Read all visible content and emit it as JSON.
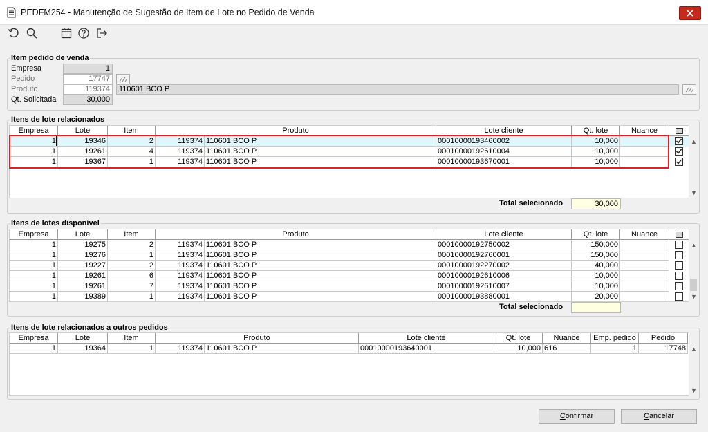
{
  "window": {
    "title": "PEDFM254 - Manutenção de Sugestão de Item de Lote no Pedido de Venda"
  },
  "icons": {
    "undo": "undo-icon",
    "search": "search-icon",
    "calendar": "calendar-icon",
    "help": "help-icon",
    "exit": "exit-icon"
  },
  "item_group": {
    "title": "Item pedido de venda",
    "empresa_label": "Empresa",
    "empresa_value": "1",
    "pedido_label": "Pedido",
    "pedido_value": "17747",
    "produto_label": "Produto",
    "produto_value": "119374",
    "produto_desc": "110601 BCO P",
    "qt_label": "Qt. Solicitada",
    "qt_value": "30,000"
  },
  "related": {
    "title": "Itens de lote relacionados",
    "headers": [
      "Empresa",
      "Lote",
      "Item",
      "Produto",
      "Lote cliente",
      "Qt. lote",
      "Nuance"
    ],
    "rows": [
      {
        "empresa": "1",
        "lote": "19346",
        "item": "2",
        "prod_code": "119374",
        "prod_desc": "110601 BCO P",
        "lote_cliente": "00010000193460002",
        "qt_lote": "10,000",
        "nuance": "",
        "checked": true
      },
      {
        "empresa": "1",
        "lote": "19261",
        "item": "4",
        "prod_code": "119374",
        "prod_desc": "110601 BCO P",
        "lote_cliente": "00010000192610004",
        "qt_lote": "10,000",
        "nuance": "",
        "checked": true
      },
      {
        "empresa": "1",
        "lote": "19367",
        "item": "1",
        "prod_code": "119374",
        "prod_desc": "110601 BCO P",
        "lote_cliente": "00010000193670001",
        "qt_lote": "10,000",
        "nuance": "",
        "checked": true
      }
    ],
    "total_label": "Total selecionado",
    "total_value": "30,000"
  },
  "available": {
    "title": "Itens de lotes disponível",
    "headers": [
      "Empresa",
      "Lote",
      "Item",
      "Produto",
      "Lote cliente",
      "Qt. lote",
      "Nuance"
    ],
    "rows": [
      {
        "empresa": "1",
        "lote": "19275",
        "item": "2",
        "prod_code": "119374",
        "prod_desc": "110601 BCO P",
        "lote_cliente": "00010000192750002",
        "qt_lote": "150,000",
        "nuance": "",
        "checked": false
      },
      {
        "empresa": "1",
        "lote": "19276",
        "item": "1",
        "prod_code": "119374",
        "prod_desc": "110601 BCO P",
        "lote_cliente": "00010000192760001",
        "qt_lote": "150,000",
        "nuance": "",
        "checked": false
      },
      {
        "empresa": "1",
        "lote": "19227",
        "item": "2",
        "prod_code": "119374",
        "prod_desc": "110601 BCO P",
        "lote_cliente": "00010000192270002",
        "qt_lote": "40,000",
        "nuance": "",
        "checked": false
      },
      {
        "empresa": "1",
        "lote": "19261",
        "item": "6",
        "prod_code": "119374",
        "prod_desc": "110601 BCO P",
        "lote_cliente": "00010000192610006",
        "qt_lote": "10,000",
        "nuance": "",
        "checked": false
      },
      {
        "empresa": "1",
        "lote": "19261",
        "item": "7",
        "prod_code": "119374",
        "prod_desc": "110601 BCO P",
        "lote_cliente": "00010000192610007",
        "qt_lote": "10,000",
        "nuance": "",
        "checked": false
      },
      {
        "empresa": "1",
        "lote": "19389",
        "item": "1",
        "prod_code": "119374",
        "prod_desc": "110601 BCO P",
        "lote_cliente": "00010000193880001",
        "qt_lote": "20,000",
        "nuance": "",
        "checked": false
      }
    ],
    "total_label": "Total selecionado",
    "total_value": ""
  },
  "other": {
    "title": "Itens de lote relacionados a outros pedidos",
    "headers": [
      "Empresa",
      "Lote",
      "Item",
      "Produto",
      "Lote cliente",
      "Qt. lote",
      "Nuance",
      "Emp. pedido",
      "Pedido"
    ],
    "rows": [
      {
        "empresa": "1",
        "lote": "19364",
        "item": "1",
        "prod_code": "119374",
        "prod_desc": "110601 BCO P",
        "lote_cliente": "00010000193640001",
        "qt_lote": "10,000",
        "nuance": "616",
        "emp_pedido": "1",
        "pedido": "17748"
      }
    ]
  },
  "buttons": {
    "confirm_pre": "",
    "confirm_u": "C",
    "confirm_post": "onfirmar",
    "cancel_pre": "",
    "cancel_u": "C",
    "cancel_post": "ancelar"
  }
}
